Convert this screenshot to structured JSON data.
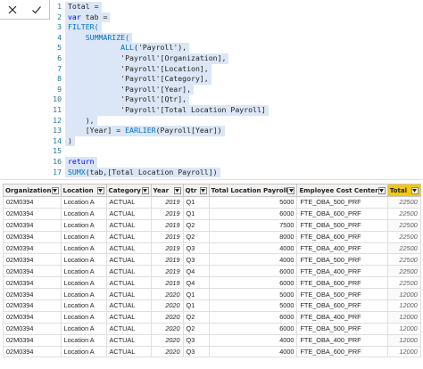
{
  "formula_bar": {
    "cancel_icon": "close-icon",
    "commit_icon": "check-icon",
    "lines": [
      {
        "n": "1",
        "tokens": [
          {
            "t": "Total =",
            "c": "plain"
          }
        ]
      },
      {
        "n": "2",
        "tokens": [
          {
            "t": "var",
            "c": "kw"
          },
          {
            "t": " tab =",
            "c": "plain"
          }
        ]
      },
      {
        "n": "3",
        "tokens": [
          {
            "t": "FILTER(",
            "c": "fn"
          }
        ]
      },
      {
        "n": "4",
        "tokens": [
          {
            "t": "    ",
            "c": "plain"
          },
          {
            "t": "SUMMARIZE(",
            "c": "fn"
          }
        ]
      },
      {
        "n": "5",
        "tokens": [
          {
            "t": "            ",
            "c": "plain"
          },
          {
            "t": "ALL",
            "c": "fn"
          },
          {
            "t": "('Payroll'),",
            "c": "plain"
          }
        ]
      },
      {
        "n": "6",
        "tokens": [
          {
            "t": "            'Payroll'[Organization],",
            "c": "plain"
          }
        ]
      },
      {
        "n": "7",
        "tokens": [
          {
            "t": "            'Payroll'[Location],",
            "c": "plain"
          }
        ]
      },
      {
        "n": "8",
        "tokens": [
          {
            "t": "            'Payroll'[Category],",
            "c": "plain"
          }
        ]
      },
      {
        "n": "9",
        "tokens": [
          {
            "t": "            'Payroll'[Year],",
            "c": "plain"
          }
        ]
      },
      {
        "n": "10",
        "tokens": [
          {
            "t": "            'Payroll'[Qtr],",
            "c": "plain"
          }
        ]
      },
      {
        "n": "11",
        "tokens": [
          {
            "t": "            'Payroll'[Total Location Payroll]",
            "c": "plain"
          }
        ]
      },
      {
        "n": "12",
        "tokens": [
          {
            "t": "    ),",
            "c": "plain"
          }
        ]
      },
      {
        "n": "13",
        "tokens": [
          {
            "t": "    [Year] = ",
            "c": "plain"
          },
          {
            "t": "EARLIER",
            "c": "fn"
          },
          {
            "t": "(Payroll[Year])",
            "c": "plain"
          }
        ]
      },
      {
        "n": "14",
        "tokens": [
          {
            "t": ")",
            "c": "plain"
          }
        ]
      },
      {
        "n": "15",
        "tokens": [
          {
            "t": "",
            "c": "plain"
          }
        ]
      },
      {
        "n": "16",
        "tokens": [
          {
            "t": "return",
            "c": "kw"
          }
        ]
      },
      {
        "n": "17",
        "tokens": [
          {
            "t": "SUMX",
            "c": "fn"
          },
          {
            "t": "(tab,[Total Location Payroll])",
            "c": "plain"
          }
        ]
      }
    ]
  },
  "table": {
    "headers": [
      "Organization",
      "Location",
      "Category",
      "Year",
      "Qtr",
      "Total Location Payroll",
      "Employee Cost Center",
      "Total"
    ],
    "rows": [
      [
        "02M0394",
        "Location A",
        "ACTUAL",
        "2019",
        "Q1",
        "5000",
        "FTE_OBA_500_PRF",
        "22500"
      ],
      [
        "02M0394",
        "Location A",
        "ACTUAL",
        "2019",
        "Q1",
        "6000",
        "FTE_OBA_600_PRF",
        "22500"
      ],
      [
        "02M0394",
        "Location A",
        "ACTUAL",
        "2019",
        "Q2",
        "7500",
        "FTE_OBA_500_PRF",
        "22500"
      ],
      [
        "02M0394",
        "Location A",
        "ACTUAL",
        "2019",
        "Q2",
        "8000",
        "FTE_OBA_600_PRF",
        "22500"
      ],
      [
        "02M0394",
        "Location A",
        "ACTUAL",
        "2019",
        "Q3",
        "4000",
        "FTE_OBA_400_PRF",
        "22500"
      ],
      [
        "02M0394",
        "Location A",
        "ACTUAL",
        "2019",
        "Q3",
        "4000",
        "FTE_OBA_500_PRF",
        "22500"
      ],
      [
        "02M0394",
        "Location A",
        "ACTUAL",
        "2019",
        "Q4",
        "6000",
        "FTE_OBA_400_PRF",
        "22500"
      ],
      [
        "02M0394",
        "Location A",
        "ACTUAL",
        "2019",
        "Q4",
        "6000",
        "FTE_OBA_600_PRF",
        "22500"
      ],
      [
        "02M0394",
        "Location A",
        "ACTUAL",
        "2020",
        "Q1",
        "5000",
        "FTE_OBA_500_PRF",
        "12000"
      ],
      [
        "02M0394",
        "Location A",
        "ACTUAL",
        "2020",
        "Q1",
        "5000",
        "FTE_OBA_600_PRF",
        "12000"
      ],
      [
        "02M0394",
        "Location A",
        "ACTUAL",
        "2020",
        "Q2",
        "6000",
        "FTE_OBA_400_PRF",
        "12000"
      ],
      [
        "02M0394",
        "Location A",
        "ACTUAL",
        "2020",
        "Q2",
        "6000",
        "FTE_OBA_500_PRF",
        "12000"
      ],
      [
        "02M0394",
        "Location A",
        "ACTUAL",
        "2020",
        "Q3",
        "4000",
        "FTE_OBA_400_PRF",
        "12000"
      ],
      [
        "02M0394",
        "Location A",
        "ACTUAL",
        "2020",
        "Q3",
        "4000",
        "FTE_OBA_600_PRF",
        "12000"
      ]
    ]
  },
  "colors": {
    "total_header": "#f2c811",
    "selection": "#dbe7f6",
    "line_number": "#237893",
    "keyword": "#0000ff",
    "function": "#0070c1"
  }
}
